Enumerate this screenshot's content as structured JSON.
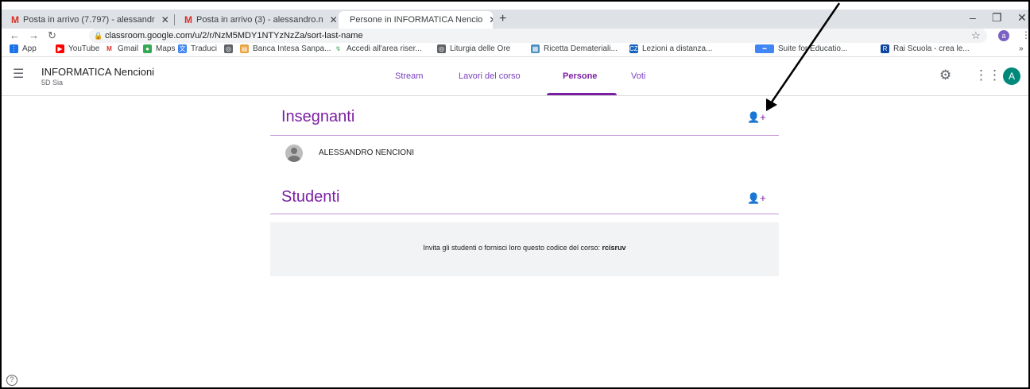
{
  "browser": {
    "tabs": [
      {
        "title": "Posta in arrivo (7.797) - alessandr",
        "close": "✕"
      },
      {
        "title": "Posta in arrivo (3) - alessandro.n",
        "close": "✕"
      },
      {
        "title": "Persone in INFORMATICA Nencio",
        "close": "✕"
      }
    ],
    "new_tab": "+",
    "url": "classroom.google.com/u/2/r/NzM5MDY1NTYzNzZa/sort-last-name",
    "profile_initial": "a",
    "bookmarks": [
      {
        "label": "App",
        "icon": "apps-grid-icon"
      },
      {
        "label": "YouTube",
        "icon": "youtube-icon"
      },
      {
        "label": "Gmail",
        "icon": "gmail-icon"
      },
      {
        "label": "Maps",
        "icon": "maps-pin-icon"
      },
      {
        "label": "Traduci",
        "icon": "translate-icon"
      },
      {
        "label": "Banca Intesa Sanpa...",
        "icon": "bank-icon"
      },
      {
        "label": "Accedi all'area riser...",
        "icon": "login-icon"
      },
      {
        "label": "Liturgia delle Ore",
        "icon": "globe-icon"
      },
      {
        "label": "Ricetta Demateriali...",
        "icon": "document-icon"
      },
      {
        "label": "Lezioni a distanza...",
        "icon": "school-icon"
      },
      {
        "label": "Suite for Educatio...",
        "icon": "gsuite-icon"
      },
      {
        "label": "Rai Scuola - crea le...",
        "icon": "rai-icon"
      }
    ],
    "more_bookmarks": "»"
  },
  "classroom": {
    "course_title": "INFORMATICA Nencioni",
    "course_section": "5D Sia",
    "nav_tabs": [
      "Stream",
      "Lavori del corso",
      "Persone",
      "Voti"
    ],
    "selected_tab": "Persone",
    "account_initial": "A"
  },
  "people": {
    "teachers_title": "Insegnanti",
    "teachers": [
      "ALESSANDRO NENCIONI"
    ],
    "students_title": "Studenti",
    "invite_text": "Invita gli studenti o fornisci loro questo codice del corso: ",
    "class_code": "rcisruv"
  },
  "colors": {
    "accent": "#7b1fa2",
    "avatar": "#00897b"
  }
}
